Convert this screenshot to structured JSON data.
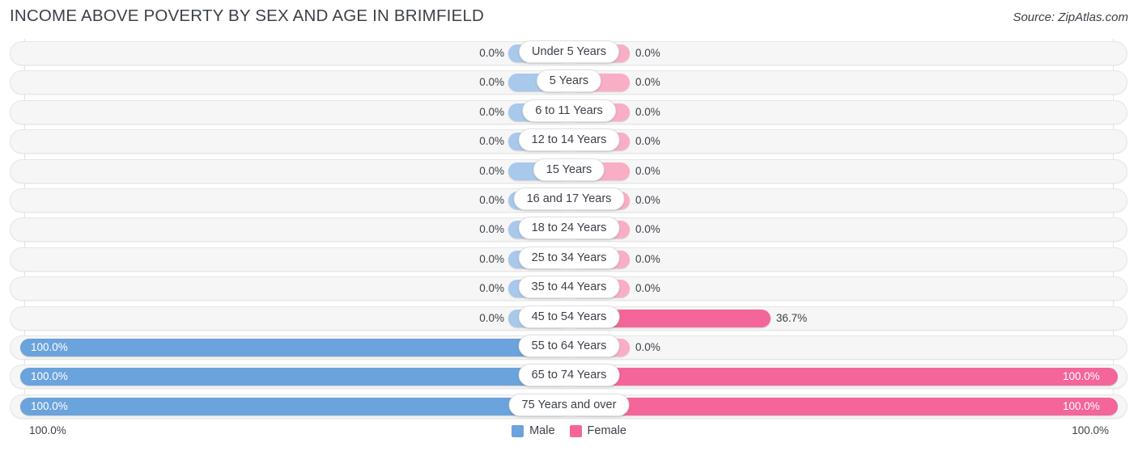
{
  "header": {
    "title": "INCOME ABOVE POVERTY BY SEX AND AGE IN BRIMFIELD",
    "source": "Source: ZipAtlas.com"
  },
  "legend": {
    "male_label": "Male",
    "female_label": "Female",
    "male_color": "#6BA3DC",
    "female_color": "#F4659A"
  },
  "axis": {
    "left_label": "100.0%",
    "right_label": "100.0%"
  },
  "colors": {
    "male_full": "#6BA3DC",
    "male_stub": "#A8C8EC",
    "female_full": "#F4659A",
    "female_stub": "#F9AEC5",
    "track": "#f6f6f6"
  },
  "chart_data": {
    "type": "bar",
    "title": "INCOME ABOVE POVERTY BY SEX AND AGE IN BRIMFIELD",
    "subtitle": "Source: ZipAtlas.com",
    "orientation": "horizontal-diverging",
    "xlabel": "",
    "ylabel": "",
    "xlim": [
      0,
      100
    ],
    "grid": false,
    "legend_position": "bottom-center",
    "categories": [
      "Under 5 Years",
      "5 Years",
      "6 to 11 Years",
      "12 to 14 Years",
      "15 Years",
      "16 and 17 Years",
      "18 to 24 Years",
      "25 to 34 Years",
      "35 to 44 Years",
      "45 to 54 Years",
      "55 to 64 Years",
      "65 to 74 Years",
      "75 Years and over"
    ],
    "series": [
      {
        "name": "Male",
        "values": [
          0.0,
          0.0,
          0.0,
          0.0,
          0.0,
          0.0,
          0.0,
          0.0,
          0.0,
          0.0,
          100.0,
          100.0,
          100.0
        ],
        "labels": [
          "0.0%",
          "0.0%",
          "0.0%",
          "0.0%",
          "0.0%",
          "0.0%",
          "0.0%",
          "0.0%",
          "0.0%",
          "0.0%",
          "100.0%",
          "100.0%",
          "100.0%"
        ]
      },
      {
        "name": "Female",
        "values": [
          0.0,
          0.0,
          0.0,
          0.0,
          0.0,
          0.0,
          0.0,
          0.0,
          0.0,
          36.7,
          0.0,
          100.0,
          100.0
        ],
        "labels": [
          "0.0%",
          "0.0%",
          "0.0%",
          "0.0%",
          "0.0%",
          "0.0%",
          "0.0%",
          "0.0%",
          "0.0%",
          "36.7%",
          "0.0%",
          "100.0%",
          "100.0%"
        ]
      }
    ]
  }
}
